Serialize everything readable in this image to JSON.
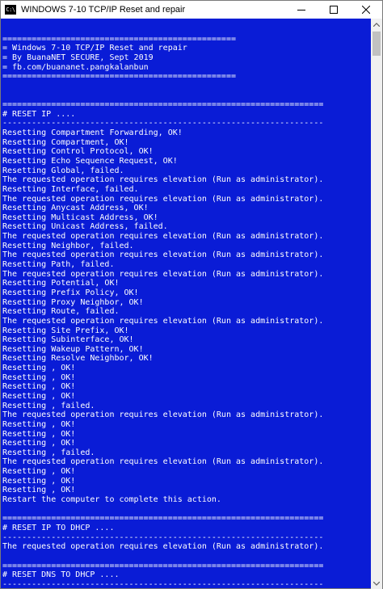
{
  "window": {
    "icon_text": "C:\\",
    "title": "WINDOWS 7-10 TCP/IP Reset and repair"
  },
  "console": {
    "lines": [
      "",
      "================================================",
      "= Windows 7-10 TCP/IP Reset and repair",
      "= By BuanaNET SECURE, Sept 2019",
      "= fb.com/buananet.pangkalanbun",
      "================================================",
      "",
      "",
      "==================================================================",
      "# RESET IP ....",
      "------------------------------------------------------------------",
      "Resetting Compartment Forwarding, OK!",
      "Resetting Compartment, OK!",
      "Resetting Control Protocol, OK!",
      "Resetting Echo Sequence Request, OK!",
      "Resetting Global, failed.",
      "The requested operation requires elevation (Run as administrator).",
      "Resetting Interface, failed.",
      "The requested operation requires elevation (Run as administrator).",
      "Resetting Anycast Address, OK!",
      "Resetting Multicast Address, OK!",
      "Resetting Unicast Address, failed.",
      "The requested operation requires elevation (Run as administrator).",
      "Resetting Neighbor, failed.",
      "The requested operation requires elevation (Run as administrator).",
      "Resetting Path, failed.",
      "The requested operation requires elevation (Run as administrator).",
      "Resetting Potential, OK!",
      "Resetting Prefix Policy, OK!",
      "Resetting Proxy Neighbor, OK!",
      "Resetting Route, failed.",
      "The requested operation requires elevation (Run as administrator).",
      "Resetting Site Prefix, OK!",
      "Resetting Subinterface, OK!",
      "Resetting Wakeup Pattern, OK!",
      "Resetting Resolve Neighbor, OK!",
      "Resetting , OK!",
      "Resetting , OK!",
      "Resetting , OK!",
      "Resetting , OK!",
      "Resetting , failed.",
      "The requested operation requires elevation (Run as administrator).",
      "Resetting , OK!",
      "Resetting , OK!",
      "Resetting , OK!",
      "Resetting , failed.",
      "The requested operation requires elevation (Run as administrator).",
      "Resetting , OK!",
      "Resetting , OK!",
      "Resetting , OK!",
      "Restart the computer to complete this action.",
      "",
      "==================================================================",
      "# RESET IP TO DHCP ....",
      "------------------------------------------------------------------",
      "The requested operation requires elevation (Run as administrator).",
      "",
      "==================================================================",
      "# RESET DNS TO DHCP ....",
      "------------------------------------------------------------------"
    ]
  },
  "colors": {
    "console_background": "#0a1cd6",
    "console_text": "#ffffff"
  }
}
